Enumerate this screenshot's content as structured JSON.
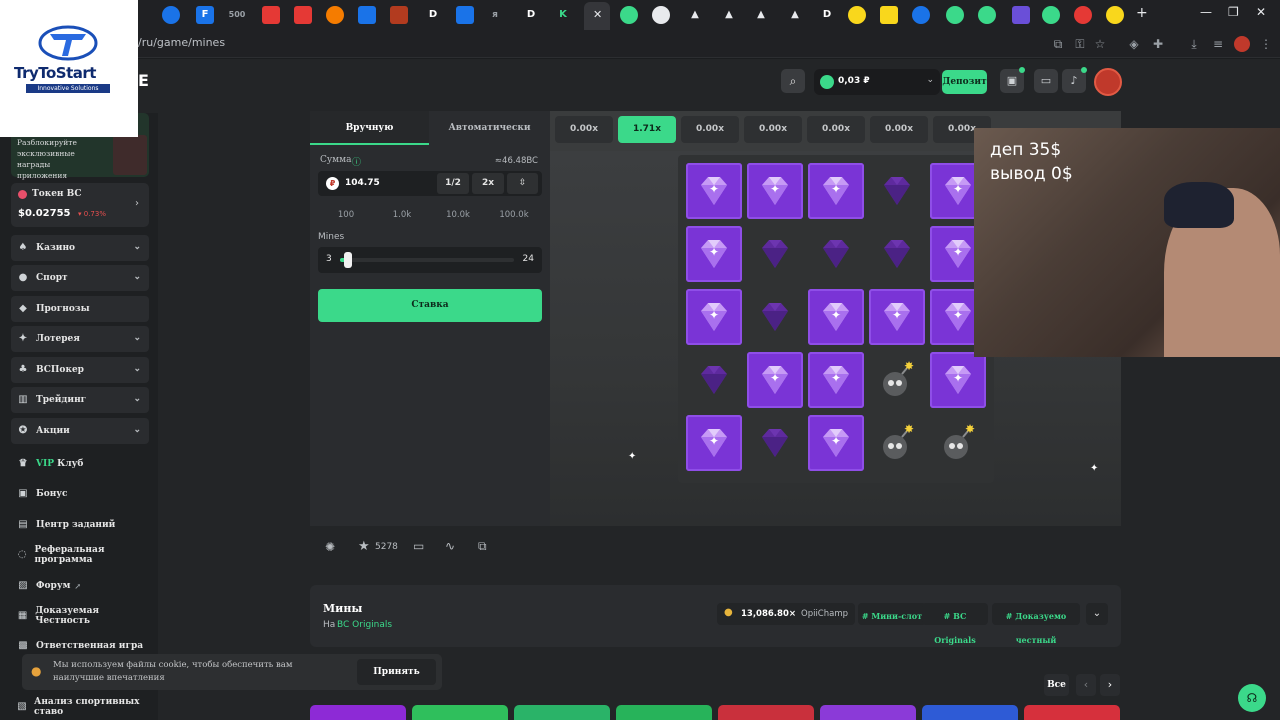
{
  "browser": {
    "url": "/ru/game/mines",
    "tabs": [
      "F",
      "500",
      "D",
      "я",
      "D",
      "K",
      "D"
    ]
  },
  "overlay": {
    "logo_text": "TryToStart",
    "logo_sub": "Innovative Solutions",
    "webcam_line1": "деп 35$",
    "webcam_line2": "вывод 0$"
  },
  "header": {
    "balance": "0,03 ₽",
    "deposit_label": "Депозит",
    "logo_letter": "E"
  },
  "sidebar": {
    "promo_text": "Разблокируйте эксклюзивные награды приложения",
    "token_title": "Токен BC",
    "token_price": "$0.02755",
    "token_change": "▾ 0.73%",
    "items": [
      {
        "label": "Казино",
        "chevron": true
      },
      {
        "label": "Спорт",
        "chevron": true
      },
      {
        "label": "Прогнозы",
        "chevron": false
      },
      {
        "label": "Лотерея",
        "chevron": true
      },
      {
        "label": "BCПокер",
        "chevron": true
      },
      {
        "label": "Трейдинг",
        "chevron": true
      },
      {
        "label": "Акции",
        "chevron": true
      }
    ],
    "vip_prefix": "VIP",
    "vip_suffix": " Клуб",
    "flat_items": [
      "Бонус",
      "Центр заданий",
      "Реферальная программа",
      "Форум",
      "Доказуемая Честность",
      "Ответственная игра",
      "Анализ спортивных ставо"
    ]
  },
  "controls": {
    "tab_manual": "Вручную",
    "tab_auto": "Автоматически",
    "amount_label": "Сумма",
    "amount_approx": "≈46.48BC",
    "amount_value": "104.75",
    "half_label": "1/2",
    "double_label": "2x",
    "quick_amounts": [
      "100",
      "1.0k",
      "10.0k",
      "100.0k"
    ],
    "mines_label": "Mines",
    "mines_min": "3",
    "mines_max": "24",
    "mines_level": 3,
    "bet_button": "Ставка"
  },
  "multipliers": [
    "0.00x",
    "1.71x",
    "0.00x",
    "0.00x",
    "0.00x",
    "0.00x",
    "0.00x"
  ],
  "active_multiplier_index": 1,
  "grid": [
    [
      "gem",
      "gem",
      "gem",
      "dim",
      "gem"
    ],
    [
      "gem",
      "dim",
      "dim",
      "dim",
      "gem"
    ],
    [
      "gem",
      "dim",
      "gem",
      "gem",
      "gem"
    ],
    [
      "dim",
      "gem",
      "gem",
      "bomb",
      "gem"
    ],
    [
      "gem",
      "dim",
      "gem",
      "bomb",
      "bomb"
    ]
  ],
  "footer_bar": {
    "favorites_count": "5278"
  },
  "game_info": {
    "title": "Мины",
    "by_prefix": "На",
    "provider": "BC Originals",
    "top_win": "13,086.80×",
    "top_player": "OpiiChamp",
    "tags": [
      "# Мини-слот",
      "# BC Originals",
      "# Доказуемо честный"
    ]
  },
  "cookie": {
    "text": "Мы используем файлы cookie, чтобы обеспечить вам наилучшие впечатления",
    "accept_label": "Принять"
  },
  "recommend": {
    "all_label": "Все"
  },
  "colors": {
    "accent": "#3bd98a",
    "gem": "#7a34d6",
    "panel": "#2a2c2f"
  }
}
